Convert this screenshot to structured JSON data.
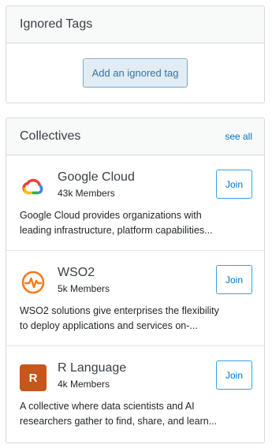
{
  "ignored_tags": {
    "title": "Ignored Tags",
    "button_label": "Add an ignored tag"
  },
  "collectives": {
    "title": "Collectives",
    "see_all": "see all",
    "items": [
      {
        "name": "Google Cloud",
        "members": "43k Members",
        "join_label": "Join",
        "description_line1": "Google Cloud provides organizations with",
        "description_line2": "leading infrastructure, platform capabilities...",
        "icon": "google-cloud-logo"
      },
      {
        "name": "WSO2",
        "members": "5k Members",
        "join_label": "Join",
        "description_line1": "WSO2 solutions give enterprises the flexibility",
        "description_line2": "to deploy applications and services on-...",
        "icon": "wso2-logo"
      },
      {
        "name": "R Language",
        "members": "4k Members",
        "join_label": "Join",
        "description_line1": "A collective where data scientists and AI",
        "description_line2": "researchers gather to find, share, and learn...",
        "icon": "r-language-logo",
        "icon_letter": "R"
      }
    ]
  },
  "colors": {
    "accent_blue": "#0074cc",
    "r_orange": "#c65619",
    "wso2_orange": "#f47b20"
  }
}
